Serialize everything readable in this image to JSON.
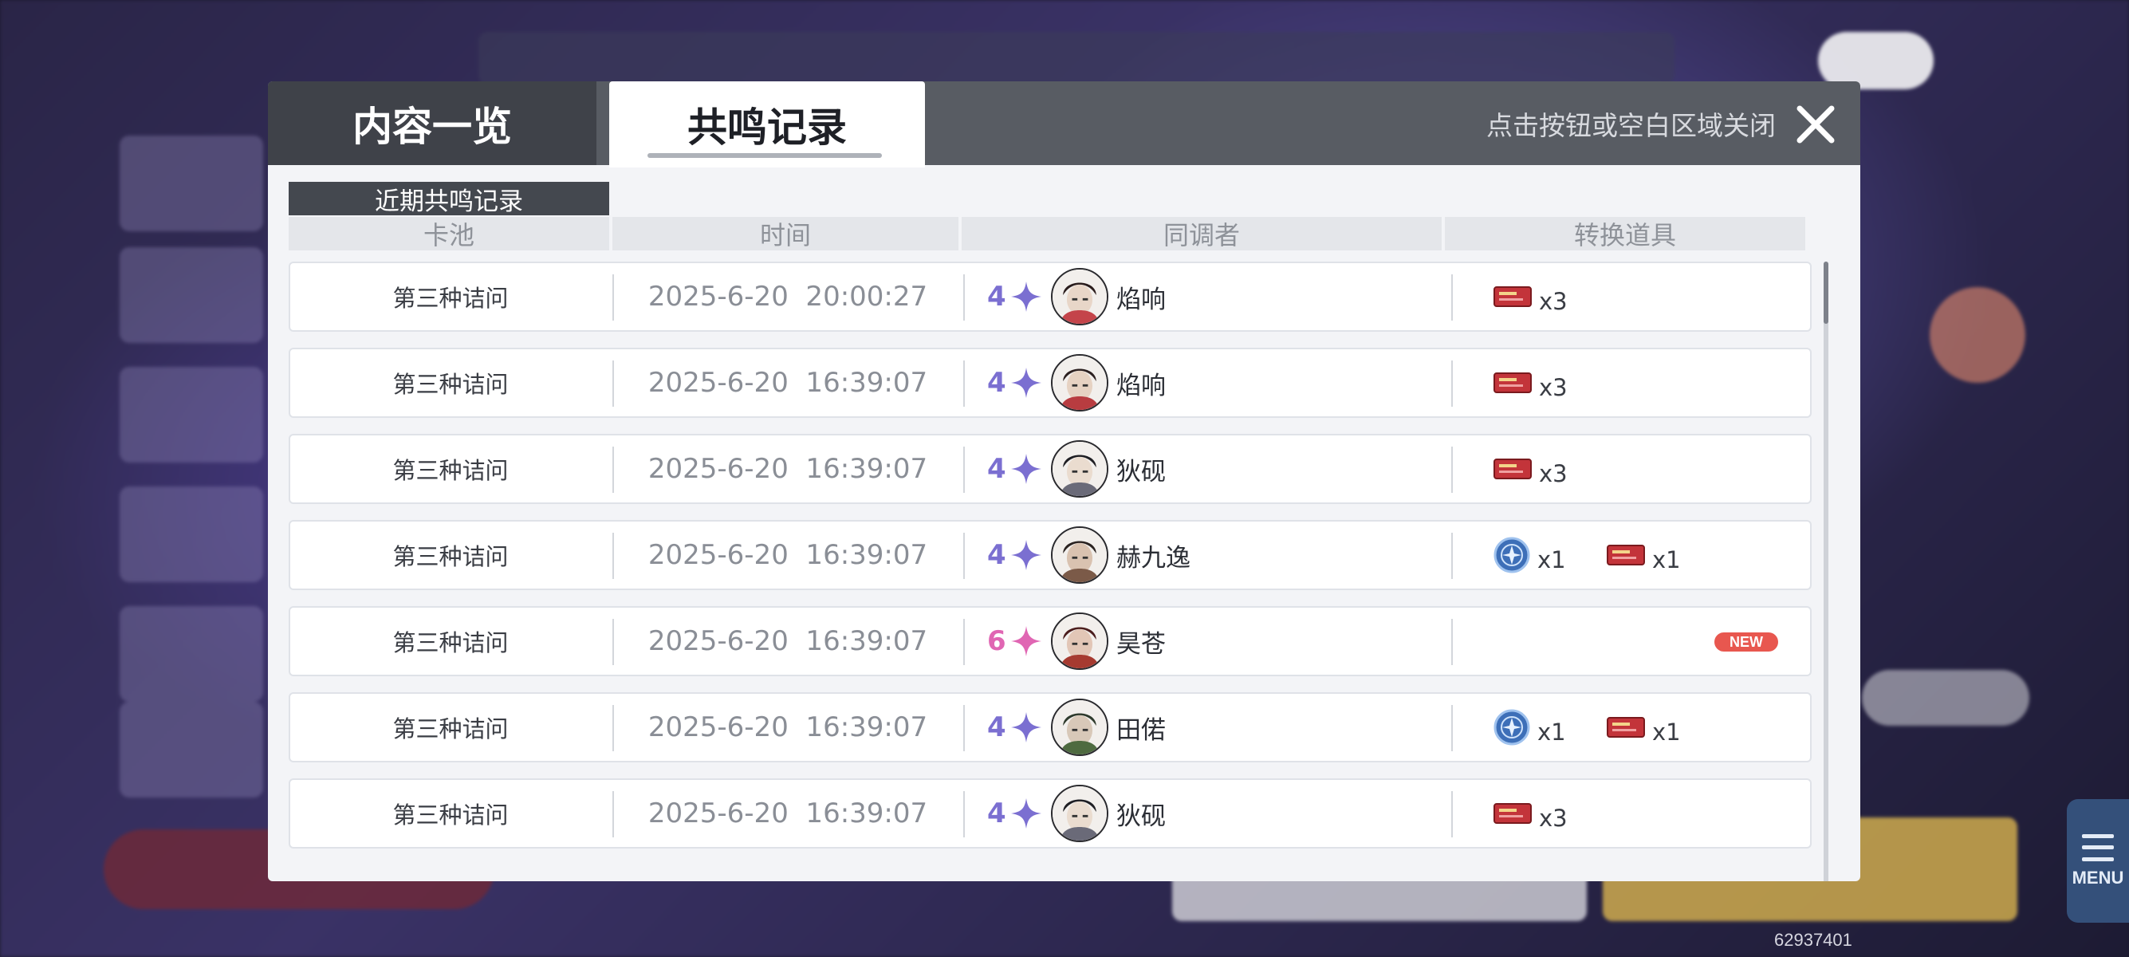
{
  "dialog": {
    "tabs": [
      {
        "label": "内容一览",
        "active": false
      },
      {
        "label": "共鸣记录",
        "active": true
      }
    ],
    "close_hint": "点击按钮或空白区域关闭",
    "section_title": "近期共鸣记录"
  },
  "columns": {
    "pool": "卡池",
    "time": "时间",
    "resonator": "同调者",
    "items": "转换道具"
  },
  "colors": {
    "rarity_4": "#7b6fd1",
    "rarity_6": "#e066b3",
    "new_badge": "#e8574f"
  },
  "records": [
    {
      "pool": "第三种诘问",
      "time": "2025-6-20  20:00:27",
      "rarity": "4",
      "name": "焰响",
      "items": [
        {
          "icon": "red-ticket-icon",
          "qty": "x3"
        }
      ]
    },
    {
      "pool": "第三种诘问",
      "time": "2025-6-20  16:39:07",
      "rarity": "4",
      "name": "焰响",
      "items": [
        {
          "icon": "red-ticket-icon",
          "qty": "x3"
        }
      ]
    },
    {
      "pool": "第三种诘问",
      "time": "2025-6-20  16:39:07",
      "rarity": "4",
      "name": "狄砚",
      "items": [
        {
          "icon": "red-ticket-icon",
          "qty": "x3"
        }
      ]
    },
    {
      "pool": "第三种诘问",
      "time": "2025-6-20  16:39:07",
      "rarity": "4",
      "name": "赫九逸",
      "items": [
        {
          "icon": "blue-coin-icon",
          "qty": "x1"
        },
        {
          "icon": "red-ticket-icon",
          "qty": "x1"
        }
      ]
    },
    {
      "pool": "第三种诘问",
      "time": "2025-6-20  16:39:07",
      "rarity": "6",
      "name": "昊苍",
      "items": [],
      "badge": "NEW"
    },
    {
      "pool": "第三种诘问",
      "time": "2025-6-20  16:39:07",
      "rarity": "4",
      "name": "田偌",
      "items": [
        {
          "icon": "blue-coin-icon",
          "qty": "x1"
        },
        {
          "icon": "red-ticket-icon",
          "qty": "x1"
        }
      ]
    },
    {
      "pool": "第三种诘问",
      "time": "2025-6-20  16:39:07",
      "rarity": "4",
      "name": "狄砚",
      "items": [
        {
          "icon": "red-ticket-icon",
          "qty": "x3"
        }
      ]
    }
  ],
  "hud": {
    "menu_label": "MENU",
    "uid": "62937401"
  }
}
